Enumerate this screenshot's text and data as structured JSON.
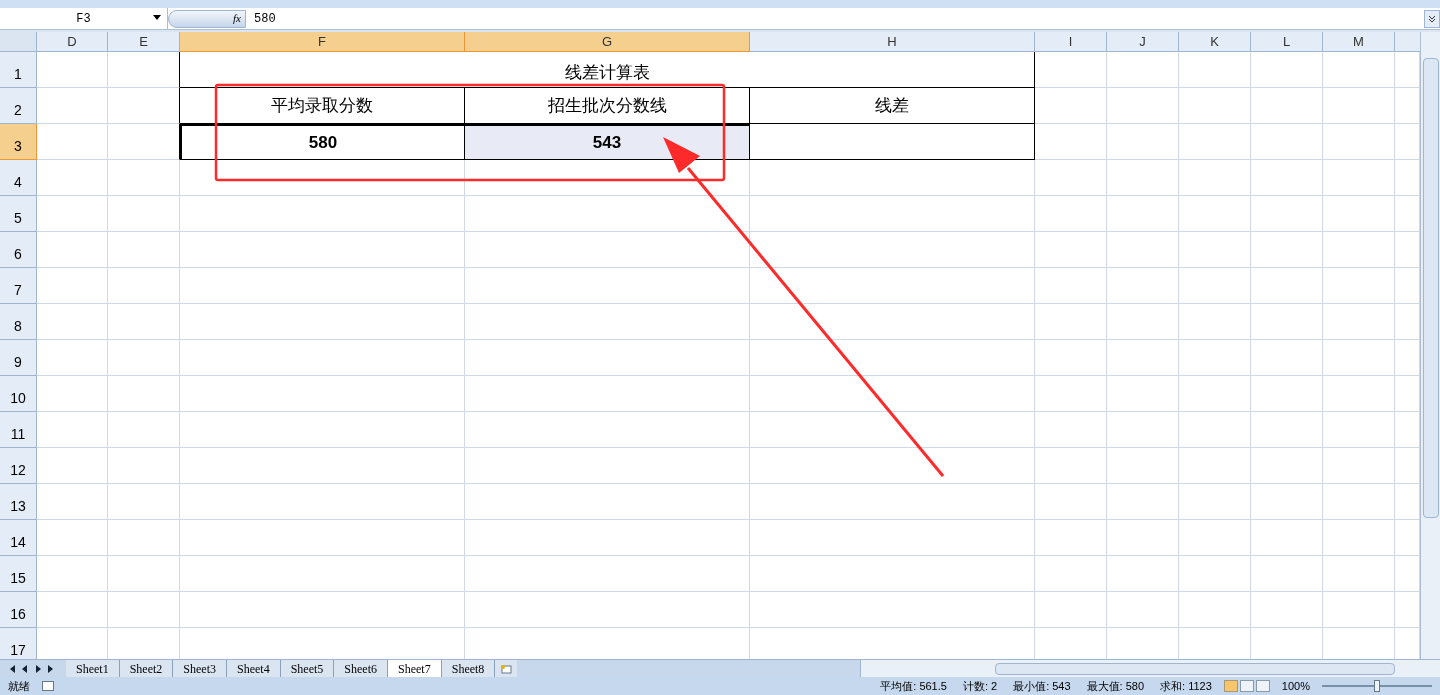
{
  "formula_bar": {
    "name_box": "F3",
    "function_label": "fx",
    "formula": "580"
  },
  "columns": [
    {
      "label": "D",
      "selected": false
    },
    {
      "label": "E",
      "selected": false
    },
    {
      "label": "F",
      "selected": true
    },
    {
      "label": "G",
      "selected": true
    },
    {
      "label": "H",
      "selected": false
    },
    {
      "label": "I",
      "selected": false
    },
    {
      "label": "J",
      "selected": false
    },
    {
      "label": "K",
      "selected": false
    },
    {
      "label": "L",
      "selected": false
    },
    {
      "label": "M",
      "selected": false
    }
  ],
  "rows": [
    {
      "label": "1",
      "selected": false
    },
    {
      "label": "2",
      "selected": false
    },
    {
      "label": "3",
      "selected": true
    },
    {
      "label": "4",
      "selected": false
    },
    {
      "label": "5",
      "selected": false
    },
    {
      "label": "6",
      "selected": false
    },
    {
      "label": "7",
      "selected": false
    },
    {
      "label": "8",
      "selected": false
    },
    {
      "label": "9",
      "selected": false
    },
    {
      "label": "10",
      "selected": false
    },
    {
      "label": "11",
      "selected": false
    },
    {
      "label": "12",
      "selected": false
    },
    {
      "label": "13",
      "selected": false
    },
    {
      "label": "14",
      "selected": false
    },
    {
      "label": "15",
      "selected": false
    },
    {
      "label": "16",
      "selected": false
    },
    {
      "label": "17",
      "selected": false
    }
  ],
  "table": {
    "title": "线差计算表",
    "headers": [
      "平均录取分数",
      "招生批次分数线",
      "线差"
    ],
    "values": [
      {
        "text": "580",
        "selected": true,
        "active": true
      },
      {
        "text": "543",
        "selected": true,
        "active": false
      }
    ]
  },
  "sheet_tabs": [
    {
      "label": "Sheet1",
      "selected": false
    },
    {
      "label": "Sheet2",
      "selected": false
    },
    {
      "label": "Sheet3",
      "selected": false
    },
    {
      "label": "Sheet4",
      "selected": false
    },
    {
      "label": "Sheet5",
      "selected": false
    },
    {
      "label": "Sheet6",
      "selected": false
    },
    {
      "label": "Sheet7",
      "selected": true
    },
    {
      "label": "Sheet8",
      "selected": false
    }
  ],
  "status_bar": {
    "mode": "就绪",
    "stats": [
      "平均值: 561.5",
      "计数: 2",
      "最小值: 543",
      "最大值: 580",
      "求和: 1123"
    ],
    "zoom": "100%",
    "zoom_slider": {
      "level": 0.5
    }
  }
}
